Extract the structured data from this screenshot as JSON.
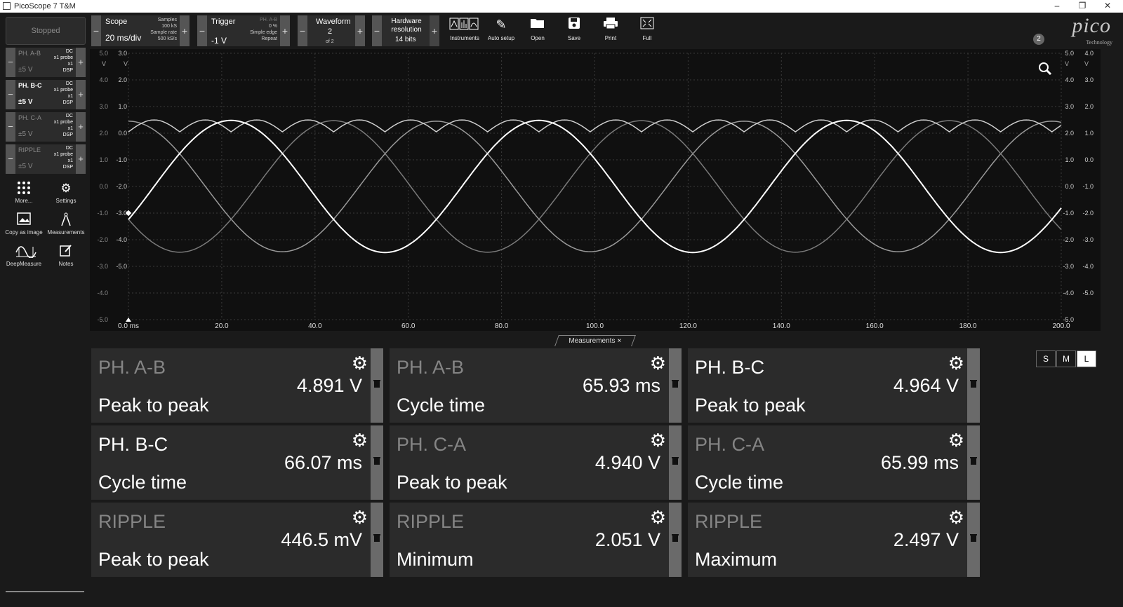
{
  "window": {
    "title": "PicoScope 7 T&M"
  },
  "toolbar": {
    "status": "Stopped",
    "scope": {
      "label": "Scope",
      "timebase": "20 ms/div",
      "samples_label": "Samples",
      "samples": "100 kS",
      "sample_rate_label": "Sample rate",
      "sample_rate": "500 kS/s"
    },
    "trigger": {
      "label": "Trigger",
      "level": "-1 V",
      "source": "PH. A-B",
      "pct": "0 %",
      "type": "Simple edge",
      "mode": "Repeat"
    },
    "waveform": {
      "label": "Waveform",
      "index": "2",
      "of": "of 2"
    },
    "hardware": {
      "label1": "Hardware",
      "label2": "resolution",
      "value": "14 bits"
    },
    "tools": [
      {
        "name": "instruments",
        "label": "Instruments"
      },
      {
        "name": "auto-setup",
        "label": "Auto setup"
      },
      {
        "name": "open",
        "label": "Open"
      },
      {
        "name": "save",
        "label": "Save"
      },
      {
        "name": "print",
        "label": "Print"
      },
      {
        "name": "full",
        "label": "Full"
      }
    ],
    "logo": {
      "brand": "pico",
      "tagline": "Technology",
      "badge": "2"
    }
  },
  "channels": [
    {
      "name": "PH. A-B",
      "range": "±5 V",
      "coupling": "DC",
      "probe": "x1 probe",
      "mult": "x1",
      "dsp": "DSP",
      "active": false
    },
    {
      "name": "PH. B-C",
      "range": "±5 V",
      "coupling": "DC",
      "probe": "x1 probe",
      "mult": "x1",
      "dsp": "DSP",
      "active": true
    },
    {
      "name": "PH. C-A",
      "range": "±5 V",
      "coupling": "DC",
      "probe": "x1 probe",
      "mult": "x1",
      "dsp": "DSP",
      "active": false
    },
    {
      "name": "RIPPLE",
      "range": "±5 V",
      "coupling": "DC",
      "probe": "x1 probe",
      "mult": "x1",
      "dsp": "DSP",
      "active": false
    }
  ],
  "sidebar_buttons": [
    {
      "name": "more",
      "label": "More..."
    },
    {
      "name": "settings",
      "label": "Settings"
    },
    {
      "name": "copy-as-image",
      "label": "Copy as image"
    },
    {
      "name": "measurements",
      "label": "Measurements"
    },
    {
      "name": "deepmeasure",
      "label": "DeepMeasure"
    },
    {
      "name": "notes",
      "label": "Notes"
    }
  ],
  "plot": {
    "x_ticks": [
      "0.0",
      "20.0",
      "40.0",
      "60.0",
      "80.0",
      "100.0",
      "120.0",
      "140.0",
      "160.0",
      "180.0",
      "200.0"
    ],
    "x_unit": "ms",
    "left_axis_a": [
      "5.0",
      "4.0",
      "3.0",
      "2.0",
      "1.0",
      "0.0",
      "-1.0",
      "-2.0",
      "-3.0",
      "-4.0",
      "-5.0"
    ],
    "left_axis_b": [
      "3.0",
      "2.0",
      "1.0",
      "0.0",
      "-1.0",
      "-2.0",
      "-3.0",
      "-4.0",
      "-5.0"
    ],
    "right_axis_a": [
      "5.0",
      "4.0",
      "3.0",
      "2.0",
      "1.0",
      "0.0",
      "-1.0",
      "-2.0",
      "-3.0",
      "-4.0",
      "-5.0"
    ],
    "right_axis_b": [
      "4.0",
      "3.0",
      "2.0",
      "1.0",
      "0.0",
      "-1.0",
      "-2.0",
      "-3.0",
      "-4.0",
      "-5.0"
    ],
    "unit": "V"
  },
  "measurements_tab": {
    "label": "Measurements",
    "close": "×"
  },
  "measurements": [
    {
      "channel": "PH. A-B",
      "value": "4.891 V",
      "name": "Peak to peak",
      "dim": true
    },
    {
      "channel": "PH. A-B",
      "value": "65.93 ms",
      "name": "Cycle time",
      "dim": true
    },
    {
      "channel": "PH. B-C",
      "value": "4.964 V",
      "name": "Peak to peak",
      "dim": false
    },
    {
      "channel": "PH. B-C",
      "value": "66.07 ms",
      "name": "Cycle time",
      "dim": false
    },
    {
      "channel": "PH. C-A",
      "value": "4.940 V",
      "name": "Peak to peak",
      "dim": true
    },
    {
      "channel": "PH. C-A",
      "value": "65.99 ms",
      "name": "Cycle time",
      "dim": true
    },
    {
      "channel": "RIPPLE",
      "value": "446.5 mV",
      "name": "Peak to peak",
      "dim": true
    },
    {
      "channel": "RIPPLE",
      "value": "2.051 V",
      "name": "Minimum",
      "dim": true
    },
    {
      "channel": "RIPPLE",
      "value": "2.497 V",
      "name": "Maximum",
      "dim": true
    }
  ],
  "size_buttons": [
    "S",
    "M",
    "L"
  ],
  "selected_size": "L",
  "waves": {
    "period_ms": 66,
    "phA": {
      "amp": 2.45,
      "offset": 0.0,
      "phase_deg": 90,
      "color": "#9a9a9a"
    },
    "phB": {
      "amp": 2.48,
      "offset": 0.0,
      "phase_deg": -30,
      "color": "#ffffff"
    },
    "phC": {
      "amp": 2.47,
      "offset": 0.0,
      "phase_deg": 210,
      "color": "#7a7a7a"
    },
    "ripple": {
      "min": 2.051,
      "max": 2.497,
      "color": "#cfcfcf"
    }
  }
}
